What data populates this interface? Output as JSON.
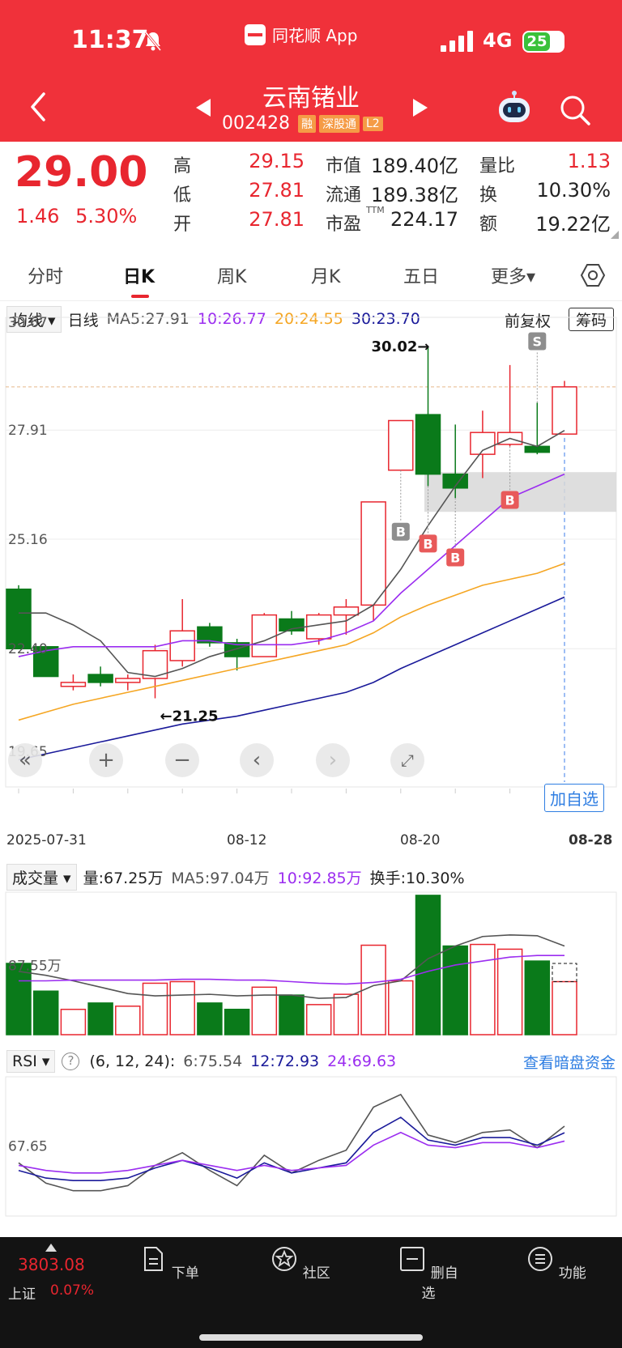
{
  "status_bar": {
    "time": "11:37",
    "app_name": "同花顺 App",
    "network": "4G",
    "battery": "25"
  },
  "header": {
    "stock_name": "云南锗业",
    "stock_code": "002428",
    "tags": [
      "融",
      "深股通",
      "L2"
    ]
  },
  "quote": {
    "price": "29.00",
    "change": "1.46",
    "change_pct": "5.30%",
    "high_label": "高",
    "high": "29.15",
    "low_label": "低",
    "low": "27.81",
    "open_label": "开",
    "open": "27.81",
    "mcap_label": "市值",
    "mcap": "189.40亿",
    "float_label": "流通",
    "float": "189.38亿",
    "pe_label": "市盈",
    "pe_sup": "TTM",
    "pe": "224.17",
    "volratio_label": "量比",
    "volratio": "1.13",
    "turnover_label": "换",
    "turnover": "10.30%",
    "amount_label": "额",
    "amount": "19.22亿"
  },
  "tabs": [
    {
      "label": "分时",
      "active": false
    },
    {
      "label": "日K",
      "active": true
    },
    {
      "label": "周K",
      "active": false
    },
    {
      "label": "月K",
      "active": false
    },
    {
      "label": "五日",
      "active": false
    },
    {
      "label": "更多▾",
      "active": false
    }
  ],
  "ma_bar": {
    "dropdown": "均线",
    "period": "日线",
    "ma5": "MA5:27.91",
    "ma10": "10:26.77",
    "ma20": "20:24.55",
    "ma30": "30:23.70",
    "adjust": "前复权",
    "chip_button": "筹码"
  },
  "price_axis": {
    "labels": [
      "30.67",
      "27.91",
      "25.16",
      "22.40",
      "19.65"
    ]
  },
  "annotations": {
    "high_mark": "30.02→",
    "low_mark": "←21.25",
    "buy": "B",
    "sell": "S",
    "add_fav": "加自选"
  },
  "dates": [
    "2025-07-31",
    "08-12",
    "08-20",
    "08-28"
  ],
  "volume_bar": {
    "dropdown": "成交量",
    "vol": "量:67.25万",
    "ma5": "MA5:97.04万",
    "ma10": "10:92.85万",
    "turnover": "换手:10.30%",
    "axis_label": "87.55万"
  },
  "rsi_bar": {
    "dropdown": "RSI",
    "params": "(6, 12, 24):",
    "rsi6": "6:75.54",
    "rsi12": "12:72.93",
    "rsi24": "24:69.63",
    "link": "查看暗盘资金",
    "axis_label": "67.65"
  },
  "colors": {
    "up": "#e8262f",
    "down": "#0a7a1a",
    "ma5": "#555555",
    "ma10": "#9b2df0",
    "ma20": "#f5a623",
    "ma30": "#1a1a9a"
  },
  "chart_data": {
    "type": "candlestick",
    "ylim": [
      19.65,
      30.67
    ],
    "candles": [
      {
        "o": 22.4,
        "c": 23.9,
        "h": 24.0,
        "l": 22.4,
        "v": 90,
        "up": false
      },
      {
        "o": 22.45,
        "c": 21.7,
        "h": 22.45,
        "l": 21.7,
        "v": 55,
        "up": false
      },
      {
        "o": 21.55,
        "c": 21.45,
        "h": 21.75,
        "l": 21.35,
        "v": 32,
        "up": true
      },
      {
        "o": 21.75,
        "c": 21.55,
        "h": 21.95,
        "l": 21.45,
        "v": 40,
        "up": false
      },
      {
        "o": 21.55,
        "c": 21.65,
        "h": 21.75,
        "l": 21.35,
        "v": 36,
        "up": true
      },
      {
        "o": 21.65,
        "c": 22.35,
        "h": 22.5,
        "l": 21.15,
        "v": 65,
        "up": true
      },
      {
        "o": 22.1,
        "c": 22.85,
        "h": 23.65,
        "l": 21.95,
        "v": 67,
        "up": true
      },
      {
        "o": 22.95,
        "c": 22.55,
        "h": 23.05,
        "l": 22.45,
        "v": 40,
        "up": false
      },
      {
        "o": 22.55,
        "c": 22.2,
        "h": 22.65,
        "l": 21.85,
        "v": 32,
        "up": false
      },
      {
        "o": 22.2,
        "c": 23.25,
        "h": 23.3,
        "l": 22.2,
        "v": 60,
        "up": true
      },
      {
        "o": 23.15,
        "c": 22.85,
        "h": 23.35,
        "l": 22.75,
        "v": 50,
        "up": false
      },
      {
        "o": 22.65,
        "c": 23.25,
        "h": 23.3,
        "l": 22.5,
        "v": 38,
        "up": true
      },
      {
        "o": 23.25,
        "c": 23.45,
        "h": 23.65,
        "l": 22.75,
        "v": 51,
        "up": true
      },
      {
        "o": 23.5,
        "c": 26.1,
        "h": 26.1,
        "l": 23.1,
        "v": 113,
        "up": true
      },
      {
        "o": 26.9,
        "c": 28.15,
        "h": 28.15,
        "l": 26.9,
        "v": 68,
        "up": true
      },
      {
        "o": 28.3,
        "c": 26.8,
        "h": 30.02,
        "l": 26.5,
        "v": 176,
        "up": false
      },
      {
        "o": 26.8,
        "c": 26.45,
        "h": 28.05,
        "l": 26.2,
        "v": 112,
        "up": false
      },
      {
        "o": 27.3,
        "c": 27.85,
        "h": 28.4,
        "l": 26.7,
        "v": 114,
        "up": true
      },
      {
        "o": 27.55,
        "c": 27.85,
        "h": 29.55,
        "l": 27.5,
        "v": 108,
        "up": true
      },
      {
        "o": 27.5,
        "c": 27.35,
        "h": 28.6,
        "l": 27.3,
        "v": 93,
        "up": false
      },
      {
        "o": 27.81,
        "c": 29.0,
        "h": 29.15,
        "l": 27.81,
        "v": 67,
        "up": true
      }
    ],
    "ma5": [
      23.3,
      23.3,
      23.0,
      22.6,
      21.8,
      21.7,
      21.9,
      22.2,
      22.4,
      22.6,
      22.9,
      23.0,
      23.1,
      23.5,
      24.4,
      25.5,
      26.5,
      27.4,
      27.7,
      27.5,
      27.9
    ],
    "ma10": [
      22.2,
      22.35,
      22.45,
      22.45,
      22.45,
      22.45,
      22.6,
      22.6,
      22.5,
      22.5,
      22.5,
      22.6,
      22.8,
      23.1,
      23.8,
      24.4,
      25.0,
      25.6,
      26.2,
      26.5,
      26.8
    ],
    "ma20": [
      20.6,
      20.8,
      21.0,
      21.15,
      21.3,
      21.45,
      21.6,
      21.75,
      21.9,
      22.05,
      22.2,
      22.35,
      22.5,
      22.8,
      23.2,
      23.5,
      23.75,
      24.0,
      24.15,
      24.3,
      24.55
    ],
    "ma30": [
      19.6,
      19.75,
      19.9,
      20.05,
      20.2,
      20.35,
      20.5,
      20.6,
      20.7,
      20.85,
      21.0,
      21.15,
      21.3,
      21.55,
      21.9,
      22.2,
      22.5,
      22.8,
      23.1,
      23.4,
      23.7
    ],
    "vol_ma5": [
      80,
      75,
      68,
      60,
      52,
      49,
      50,
      51,
      49,
      50,
      50,
      46,
      47,
      62,
      68,
      96,
      112,
      124,
      126,
      125,
      112
    ],
    "vol_ma10": [
      68,
      68,
      69,
      69,
      69,
      69,
      70,
      70,
      69,
      69,
      67,
      65,
      64,
      66,
      70,
      80,
      88,
      93,
      98,
      100,
      100
    ],
    "rsi6": [
      61,
      53,
      50,
      50,
      52,
      60,
      65,
      58,
      52,
      64,
      57,
      62,
      66,
      83,
      88,
      72,
      69,
      73,
      74,
      67,
      75.5
    ],
    "rsi12": [
      58,
      55,
      54,
      54,
      55,
      59,
      62,
      59,
      55,
      61,
      57,
      59,
      61,
      73,
      79,
      70,
      68,
      71,
      71,
      68,
      72.9
    ],
    "rsi24": [
      60,
      58,
      57,
      57,
      58,
      60,
      62,
      60,
      58,
      60,
      58,
      59,
      60,
      68,
      73,
      68,
      67,
      69,
      69,
      67,
      69.6
    ]
  },
  "bottom_bar": {
    "index_value": "3803.08",
    "index_name": "上证",
    "index_pct": "0.07%",
    "items": [
      {
        "label": "下单"
      },
      {
        "label": "社区"
      },
      {
        "label": "删自选"
      },
      {
        "label": "功能"
      }
    ]
  }
}
